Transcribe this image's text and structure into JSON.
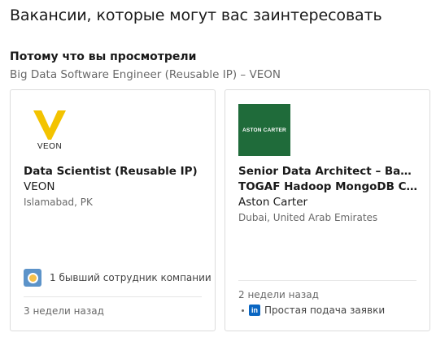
{
  "section": {
    "title": "Вакансии, которые могут вас заинтересовать",
    "because_label": "Потому что вы просмотрели",
    "because_job": "Big Data Software Engineer (Reusable IP) – VEON"
  },
  "cards": [
    {
      "logo_text": "VEON",
      "title": "Data Scientist (Reusable IP)",
      "company": "VEON",
      "location": "Islamabad, PK",
      "insight": "1 бывший сотрудник компании",
      "time": "3 недели назад"
    },
    {
      "logo_text": "ASTON CARTER",
      "title_line1": "Senior Data Architect – Banking",
      "title_line2": "TOGAF Hadoop MongoDB Cassa…",
      "company": "Aston Carter",
      "location": "Dubai, United Arab Emirates",
      "time": "2 недели назад",
      "easy_apply": "Простая подача заявки"
    }
  ],
  "icons": {
    "veon_logo": "veon-logo",
    "aston_logo": "aston-carter-logo",
    "insight": "company-alumni-icon",
    "linkedin": "linkedin-icon"
  },
  "colors": {
    "veon_yellow": "#f3c300",
    "aston_green": "#1f6b3a",
    "linkedin_blue": "#0a66c2"
  }
}
